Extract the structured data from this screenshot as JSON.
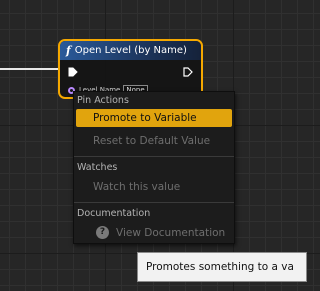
{
  "node": {
    "function_icon": "f",
    "title": "Open Level (by Name)",
    "pin_label": "Level Name",
    "pin_value": "None"
  },
  "menu": {
    "pin_actions_header": "Pin Actions",
    "promote_label": "Promote to Variable",
    "reset_label": "Reset to Default Value",
    "watches_header": "Watches",
    "watch_label": "Watch this value",
    "documentation_header": "Documentation",
    "help_icon_glyph": "?",
    "view_docs_label": "View Documentation"
  },
  "tooltip": {
    "text": "Promotes something to a va"
  },
  "colors": {
    "node_border": "#f5a800",
    "highlight": "#e1a40d",
    "header_blue": "#2a5a9a",
    "pin_purple": "#b98aff"
  },
  "icons": {
    "exec_in": "exec-pin-icon",
    "exec_out": "exec-pin-icon",
    "function": "function-icon",
    "help": "help-icon"
  }
}
